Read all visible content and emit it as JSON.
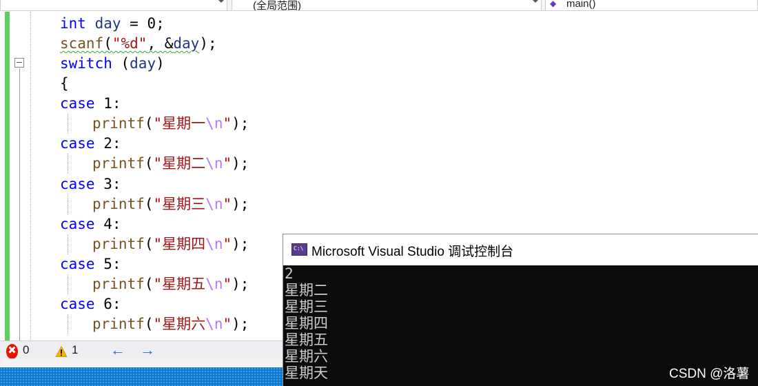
{
  "navbar": {
    "project_label": "",
    "scope_label": "(全局范围)",
    "member_label": "main()",
    "member_icon": "method-icon"
  },
  "code_lines": [
    {
      "tokens": [
        {
          "t": "int",
          "c": "kw"
        },
        {
          "t": " "
        },
        {
          "t": "day",
          "c": "var"
        },
        {
          "t": " = 0;"
        }
      ]
    },
    {
      "tokens": [
        {
          "t": "scanf",
          "c": "fn squiggle"
        },
        {
          "t": "(",
          "c": "squiggle"
        },
        {
          "t": "\"%d\"",
          "c": "str squiggle"
        },
        {
          "t": ", &",
          "c": "squiggle"
        },
        {
          "t": "day",
          "c": "var squiggle"
        },
        {
          "t": ");"
        }
      ]
    },
    {
      "tokens": [
        {
          "t": "switch",
          "c": "kw"
        },
        {
          "t": " ("
        },
        {
          "t": "day",
          "c": "var"
        },
        {
          "t": ")"
        }
      ]
    },
    {
      "tokens": [
        {
          "t": "{"
        }
      ]
    },
    {
      "tokens": [
        {
          "t": "case",
          "c": "kw"
        },
        {
          "t": " 1:"
        }
      ]
    },
    {
      "indent": true,
      "tokens": [
        {
          "t": "printf",
          "c": "fn"
        },
        {
          "t": "("
        },
        {
          "t": "\"星期一",
          "c": "str"
        },
        {
          "t": "\\n",
          "c": "esc"
        },
        {
          "t": "\"",
          "c": "str"
        },
        {
          "t": ");"
        }
      ]
    },
    {
      "tokens": [
        {
          "t": "case",
          "c": "kw"
        },
        {
          "t": " 2:"
        }
      ]
    },
    {
      "indent": true,
      "tokens": [
        {
          "t": "printf",
          "c": "fn"
        },
        {
          "t": "("
        },
        {
          "t": "\"星期二",
          "c": "str"
        },
        {
          "t": "\\n",
          "c": "esc"
        },
        {
          "t": "\"",
          "c": "str"
        },
        {
          "t": ");"
        }
      ]
    },
    {
      "tokens": [
        {
          "t": "case",
          "c": "kw"
        },
        {
          "t": " 3:"
        }
      ]
    },
    {
      "indent": true,
      "tokens": [
        {
          "t": "printf",
          "c": "fn"
        },
        {
          "t": "("
        },
        {
          "t": "\"星期三",
          "c": "str"
        },
        {
          "t": "\\n",
          "c": "esc"
        },
        {
          "t": "\"",
          "c": "str"
        },
        {
          "t": ");"
        }
      ]
    },
    {
      "tokens": [
        {
          "t": "case",
          "c": "kw"
        },
        {
          "t": " 4:"
        }
      ]
    },
    {
      "indent": true,
      "tokens": [
        {
          "t": "printf",
          "c": "fn"
        },
        {
          "t": "("
        },
        {
          "t": "\"星期四",
          "c": "str"
        },
        {
          "t": "\\n",
          "c": "esc"
        },
        {
          "t": "\"",
          "c": "str"
        },
        {
          "t": ");"
        }
      ]
    },
    {
      "tokens": [
        {
          "t": "case",
          "c": "kw"
        },
        {
          "t": " 5:"
        }
      ]
    },
    {
      "indent": true,
      "tokens": [
        {
          "t": "printf",
          "c": "fn"
        },
        {
          "t": "("
        },
        {
          "t": "\"星期五",
          "c": "str"
        },
        {
          "t": "\\n",
          "c": "esc"
        },
        {
          "t": "\"",
          "c": "str"
        },
        {
          "t": ");"
        }
      ]
    },
    {
      "tokens": [
        {
          "t": "case",
          "c": "kw"
        },
        {
          "t": " 6:"
        }
      ]
    },
    {
      "indent": true,
      "tokens": [
        {
          "t": "printf",
          "c": "fn"
        },
        {
          "t": "("
        },
        {
          "t": "\"星期六",
          "c": "str"
        },
        {
          "t": "\\n",
          "c": "esc"
        },
        {
          "t": "\"",
          "c": "str"
        },
        {
          "t": ");"
        }
      ]
    }
  ],
  "status": {
    "error_count": "0",
    "warning_count": "1",
    "error_icon": "error-icon",
    "warning_icon": "warning-icon",
    "back_arrow": "←",
    "forward_arrow": "→"
  },
  "console": {
    "title": "Microsoft Visual Studio 调试控制台",
    "icon_text": "C:\\",
    "output": [
      "2",
      "星期二",
      "星期三",
      "星期四",
      "星期五",
      "星期六",
      "星期天"
    ]
  },
  "watermark": "CSDN @洛薯",
  "colors": {
    "keyword": "#0000ff",
    "function": "#74531f",
    "string": "#a31515",
    "escape": "#b776fb",
    "variable": "#1f377f",
    "change_bar": "#5cd25c",
    "console_bg": "#0c0c0c",
    "status_blue": "#0b7bd1"
  }
}
